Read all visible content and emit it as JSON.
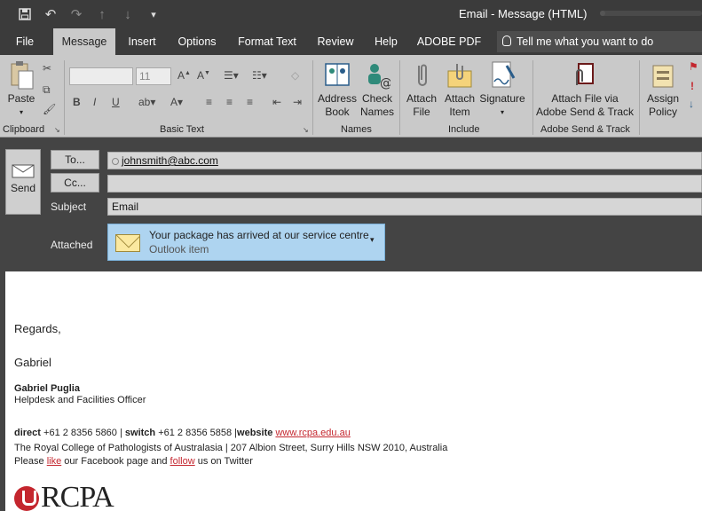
{
  "window": {
    "title": "Email  -  Message (HTML)"
  },
  "tabs": [
    {
      "label": "File"
    },
    {
      "label": "Message"
    },
    {
      "label": "Insert"
    },
    {
      "label": "Options"
    },
    {
      "label": "Format Text"
    },
    {
      "label": "Review"
    },
    {
      "label": "Help"
    },
    {
      "label": "ADOBE PDF"
    }
  ],
  "tell_me": {
    "placeholder": "Tell me what you want to do"
  },
  "ribbon": {
    "clipboard": {
      "label": "Clipboard",
      "paste": "Paste"
    },
    "basic_text": {
      "label": "Basic Text",
      "font_size": "11"
    },
    "names": {
      "label": "Names",
      "address_book": "Address Book",
      "check_names": "Check Names"
    },
    "include": {
      "label": "Include",
      "attach_file": "Attach File",
      "attach_item": "Attach Item",
      "signature": "Signature"
    },
    "adobe": {
      "label": "Adobe Send & Track",
      "attach_via": "Attach File via Adobe Send & Track"
    },
    "tags": {
      "assign_policy": "Assign Policy"
    }
  },
  "compose": {
    "send": "Send",
    "to_button": "To...",
    "cc_button": "Cc...",
    "to_value": "johnsmith@abc.com",
    "cc_value": "",
    "subject_label": "Subject",
    "subject_value": "Email",
    "attached_label": "Attached",
    "attachment": {
      "name": "Your package has arrived at our service centre",
      "type": "Outlook item"
    }
  },
  "body": {
    "regards": "Regards,",
    "first_name": "Gabriel",
    "sig_name": "Gabriel Puglia",
    "sig_title": "Helpdesk and Facilities Officer",
    "direct_label": "direct",
    "direct_value": "+61 2 8356 5860",
    "switch_label": "switch",
    "switch_value": "+61 2 8356 5858",
    "website_label": "website",
    "website_value": "www.rcpa.edu.au",
    "org_line": "The Royal College of Pathologists of Australasia | 207 Albion Street, Surry Hills NSW 2010, Australia",
    "fb_pre": "Please",
    "fb_like": "like",
    "fb_mid": "our Facebook page and",
    "fb_follow": "follow",
    "fb_post": "us on Twitter",
    "logo_text": "RCPA"
  }
}
